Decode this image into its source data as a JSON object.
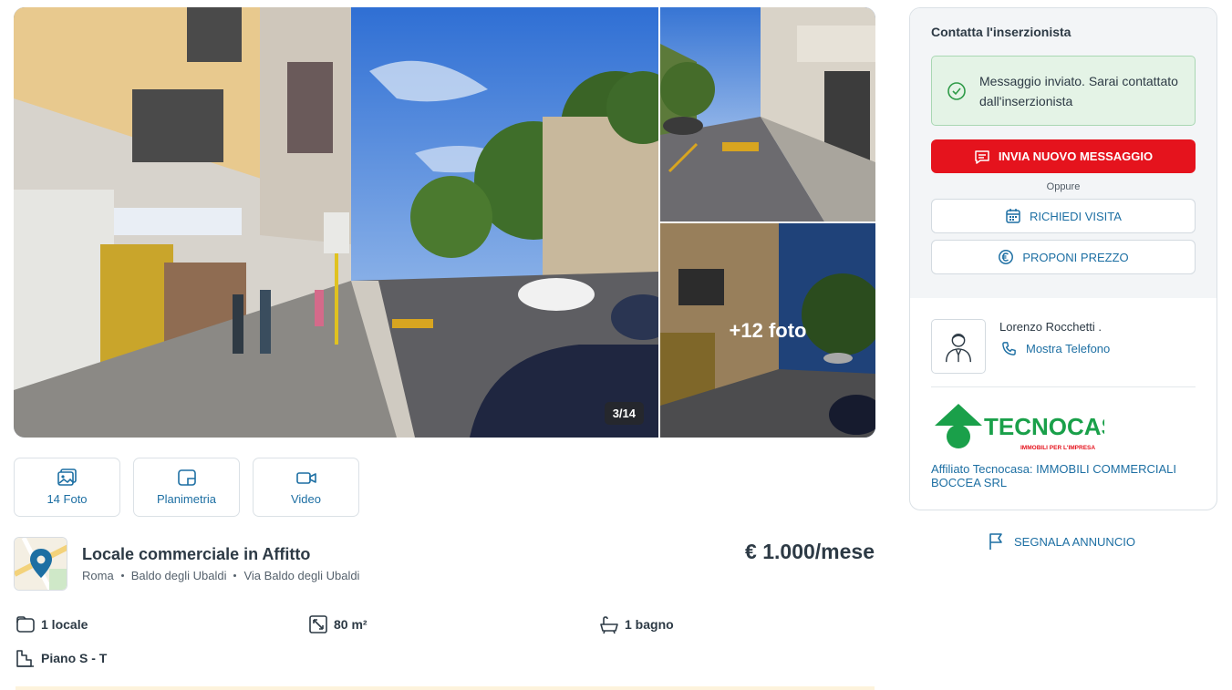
{
  "gallery": {
    "counter": "3/14",
    "more_photos_label": "+12 foto"
  },
  "media_buttons": [
    {
      "label": "14 Foto",
      "icon": "photo-icon"
    },
    {
      "label": "Planimetria",
      "icon": "floorplan-icon"
    },
    {
      "label": "Video",
      "icon": "video-icon"
    }
  ],
  "listing": {
    "title": "Locale commerciale in Affitto",
    "address": [
      "Roma",
      "Baldo degli Ubaldi",
      "Via Baldo degli Ubaldi"
    ],
    "price": "€ 1.000/mese"
  },
  "features": {
    "rooms": "1 locale",
    "area": "80 m²",
    "bathrooms": "1 bagno",
    "floor": "Piano S - T"
  },
  "contact": {
    "title": "Contatta l'inserzionista",
    "success_message": "Messaggio inviato. Sarai contattato dall'inserzionista",
    "new_message_button": "INVIA NUOVO MESSAGGIO",
    "or_label": "Oppure",
    "visit_button": "RICHIEDI VISITA",
    "offer_button": "PROPONI PREZZO",
    "agent_name": "Lorenzo Rocchetti .",
    "show_phone": "Mostra Telefono",
    "agency_logo_text": "TECNOCASA",
    "agency_logo_tagline": "IMMOBILI PER L'IMPRESA",
    "agency_name": "Affiliato Tecnocasa: IMMOBILI COMMERCIALI BOCCEA SRL"
  },
  "report": {
    "label": "SEGNALA ANNUNCIO"
  },
  "colors": {
    "accent_blue": "#1d6fa3",
    "action_red": "#e5131d",
    "success_green": "#e4f3e6",
    "brand_green": "#1aa04a"
  }
}
